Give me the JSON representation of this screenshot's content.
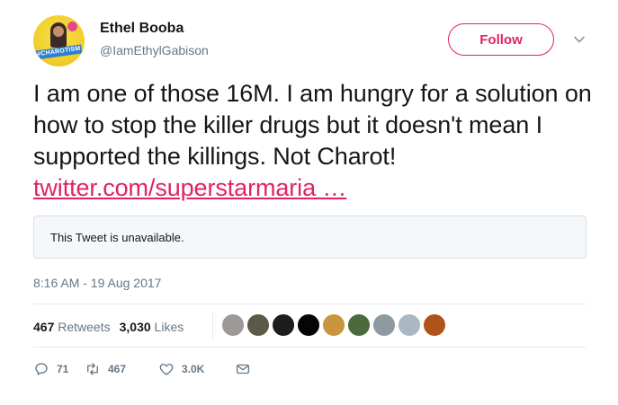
{
  "author": {
    "name": "Ethel Booba",
    "handle": "@IamEthylGabison",
    "avatar_badge": "#CHAROTISM"
  },
  "follow_button": {
    "label": "Follow"
  },
  "tweet": {
    "text": "I am one of those 16M. I am hungry for a solution on how to stop the killer drugs but it doesn't mean I supported the killings. Not Charot! ",
    "link_text": "twitter.com/superstarmaria",
    "ellipsis": " …",
    "quote_unavailable": "This Tweet is unavailable.",
    "timestamp": "8:16 AM - 19 Aug 2017"
  },
  "stats": {
    "retweets_count": "467",
    "retweets_label": "Retweets",
    "likes_count": "3,030",
    "likes_label": "Likes"
  },
  "likers": [
    {
      "name": "liker-avatar-1",
      "color": "#9c9a96"
    },
    {
      "name": "liker-avatar-2",
      "color": "#5b5a46"
    },
    {
      "name": "liker-avatar-3",
      "color": "#1d1d1d"
    },
    {
      "name": "liker-avatar-4",
      "color": "#050505"
    },
    {
      "name": "liker-avatar-5",
      "color": "#c9963e"
    },
    {
      "name": "liker-avatar-6",
      "color": "#4d6a3c"
    },
    {
      "name": "liker-avatar-7",
      "color": "#8d9aa1"
    },
    {
      "name": "liker-avatar-8",
      "color": "#aab8c2"
    },
    {
      "name": "liker-avatar-9",
      "color": "#b0531b"
    }
  ],
  "actions": {
    "reply_count": "71",
    "retweet_count": "467",
    "like_count": "3.0K"
  },
  "colors": {
    "accent": "#e0245e",
    "text": "#14171a",
    "secondary": "#657786",
    "border": "#e6ecf0"
  }
}
